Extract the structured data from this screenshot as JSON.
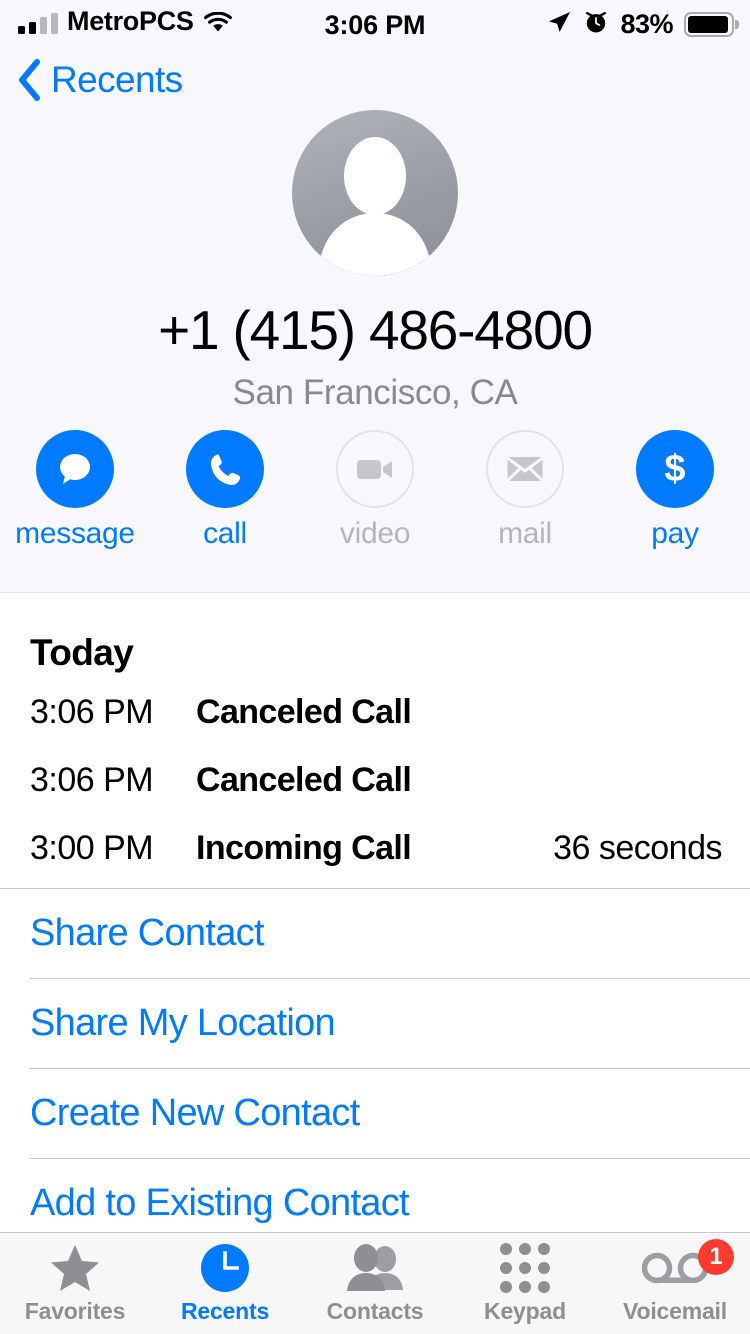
{
  "status_bar": {
    "carrier": "MetroPCS",
    "time": "3:06 PM",
    "battery_percent": "83%",
    "battery_level": 83,
    "icons": [
      "signal-bars-icon",
      "wifi-icon",
      "location-arrow-icon",
      "alarm-clock-icon",
      "battery-icon"
    ]
  },
  "nav": {
    "back_label": "Recents"
  },
  "contact": {
    "avatar": "default-person-avatar",
    "phone_number": "+1 (415) 486-4800",
    "location": "San Francisco, CA"
  },
  "actions": [
    {
      "id": "message",
      "label": "message",
      "icon": "message-bubble-icon",
      "enabled": true
    },
    {
      "id": "call",
      "label": "call",
      "icon": "phone-handset-icon",
      "enabled": true
    },
    {
      "id": "video",
      "label": "video",
      "icon": "video-camera-icon",
      "enabled": false
    },
    {
      "id": "mail",
      "label": "mail",
      "icon": "envelope-icon",
      "enabled": false
    },
    {
      "id": "pay",
      "label": "pay",
      "icon": "dollar-sign-icon",
      "enabled": true
    }
  ],
  "history": {
    "day_title": "Today",
    "calls": [
      {
        "time": "3:06 PM",
        "type": "Canceled Call",
        "duration": ""
      },
      {
        "time": "3:06 PM",
        "type": "Canceled Call",
        "duration": ""
      },
      {
        "time": "3:00 PM",
        "type": "Incoming Call",
        "duration": "36 seconds"
      }
    ]
  },
  "list_actions": [
    {
      "label": "Share Contact"
    },
    {
      "label": "Share My Location"
    },
    {
      "label": "Create New Contact"
    },
    {
      "label": "Add to Existing Contact"
    }
  ],
  "tabs": [
    {
      "label": "Favorites",
      "icon": "star-icon",
      "active": false,
      "badge": ""
    },
    {
      "label": "Recents",
      "icon": "clock-icon",
      "active": true,
      "badge": ""
    },
    {
      "label": "Contacts",
      "icon": "people-icon",
      "active": false,
      "badge": ""
    },
    {
      "label": "Keypad",
      "icon": "keypad-icon",
      "active": false,
      "badge": ""
    },
    {
      "label": "Voicemail",
      "icon": "voicemail-icon",
      "active": false,
      "badge": "1"
    }
  ],
  "colors": {
    "accent": "#007AFF",
    "badge": "#FF3B30",
    "disabled": "#B6B6BA",
    "header_bg": "#F8F8FC",
    "tabbar_bg": "#F7F7F7"
  }
}
